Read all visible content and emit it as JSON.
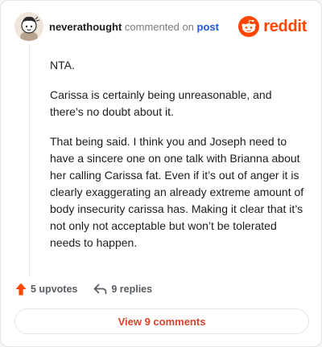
{
  "header": {
    "username": "neverathought",
    "action_text": "commented on",
    "post_link": "post",
    "brand_name": "reddit"
  },
  "comment": {
    "paragraphs": [
      "NTA.",
      "Carissa is certainly being unreasonable, and there’s no doubt about it.",
      "That being said. I think you and Joseph need to have a sincere one on one talk with Brianna about her calling Carissa fat. Even if it’s out of anger it is clearly exaggerating an already extreme amount of body insecurity carissa has. Making it clear that it’s not only not acceptable but won’t be tolerated needs to happen."
    ]
  },
  "footer": {
    "upvotes": "5 upvotes",
    "replies": "9 replies"
  },
  "view_button": "View 9 comments",
  "colors": {
    "brand": "#ff4500",
    "link": "#1a5bd6",
    "button_text": "#d9432a"
  },
  "icons": {
    "avatar": "user-avatar",
    "logo": "reddit-alien-icon",
    "upvote": "upvote-arrow-icon",
    "reply": "reply-arrow-icon"
  }
}
